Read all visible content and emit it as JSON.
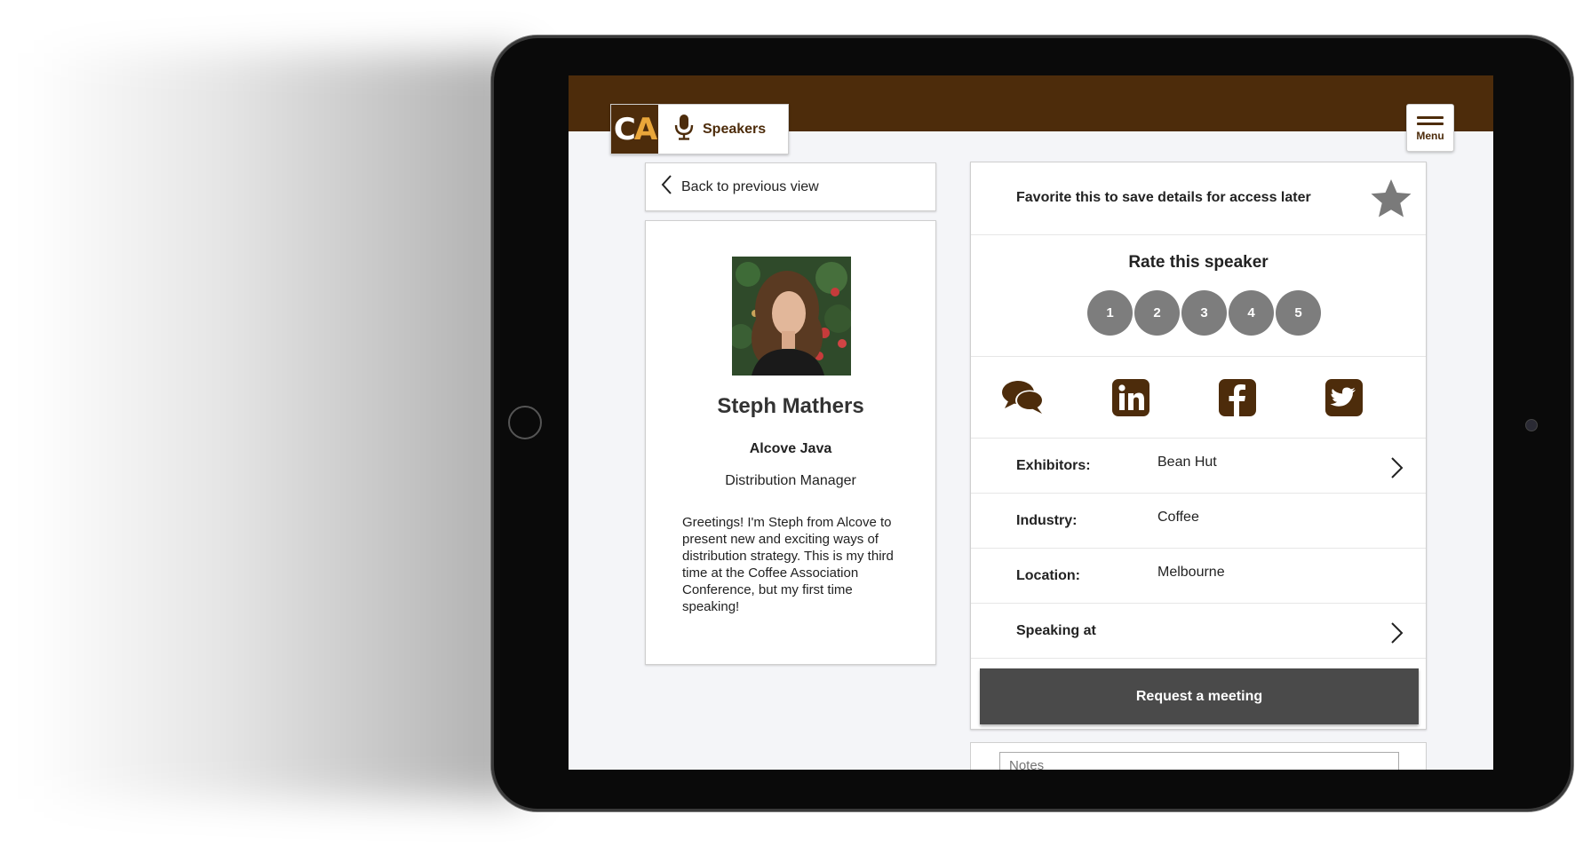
{
  "header": {
    "logo_letter_1": "C",
    "logo_letter_2": "A",
    "section_label": "Speakers",
    "menu_label": "Menu"
  },
  "nav": {
    "back_label": "Back to previous view"
  },
  "profile": {
    "name": "Steph Mathers",
    "company": "Alcove Java",
    "job_title": "Distribution Manager",
    "bio": "Greetings! I'm Steph from Alcove to present new and exciting ways of distribution strategy. This is my third time at the Coffee Association Conference, but my first time speaking!"
  },
  "favorite": {
    "text": "Favorite this to save details for access later",
    "icon": "star-icon"
  },
  "rating": {
    "title": "Rate this speaker",
    "options": [
      "1",
      "2",
      "3",
      "4",
      "5"
    ]
  },
  "social": [
    "chat-icon",
    "linkedin-icon",
    "facebook-icon",
    "twitter-icon"
  ],
  "details": {
    "exhibitors_label": "Exhibitors:",
    "exhibitors_value": "Bean Hut",
    "industry_label": "Industry:",
    "industry_value": "Coffee",
    "location_label": "Location:",
    "location_value": "Melbourne",
    "speaking_label": "Speaking at"
  },
  "actions": {
    "request_meeting": "Request a meeting"
  },
  "notes": {
    "placeholder": "Notes"
  },
  "colors": {
    "brand_brown": "#4d2c0b",
    "brand_gold": "#e9a63a",
    "button_dark": "#4a4a4a",
    "rating_gray": "#7d7d7d"
  }
}
